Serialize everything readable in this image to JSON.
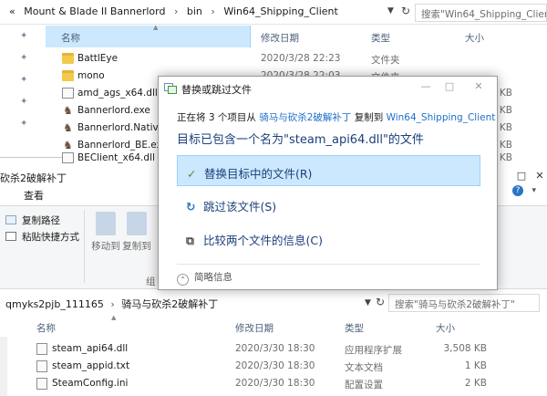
{
  "top_window": {
    "breadcrumb": [
      "«",
      "Mount & Blade II Bannerlord",
      "bin",
      "Win64_Shipping_Client"
    ],
    "breadcrumb_sep": "›",
    "search_placeholder": "搜索\"Win64_Shipping_Client\"",
    "columns": {
      "name": "名称",
      "date": "修改日期",
      "type": "类型",
      "size": "大小"
    },
    "files": [
      {
        "name": "BattlEye",
        "date": "2020/3/28 22:23",
        "type": "文件夹",
        "size": "",
        "icon": "folder"
      },
      {
        "name": "mono",
        "date": "2020/3/28 22:03",
        "type": "文件夹",
        "size": "",
        "icon": "folder"
      },
      {
        "name": "amd_ags_x64.dll",
        "date": "",
        "type": "",
        "size": "KB",
        "icon": "dll"
      },
      {
        "name": "Bannerlord.exe",
        "date": "",
        "type": "",
        "size": "KB",
        "icon": "exe"
      },
      {
        "name": "Bannerlord.Native",
        "date": "",
        "type": "",
        "size": "KB",
        "icon": "exe"
      },
      {
        "name": "Bannerlord_BE.exe",
        "date": "",
        "type": "",
        "size": "KB",
        "icon": "exe"
      },
      {
        "name": "BEClient_x64.dll",
        "date": "",
        "type": "",
        "size": "KB",
        "icon": "dll"
      }
    ]
  },
  "bottom_window": {
    "title": "砍杀2破解补丁",
    "controls": {
      "minimize": "—",
      "maximize": "□",
      "close": "✕"
    },
    "tab_view": "查看",
    "ribbon": {
      "copy_path": "复制路径",
      "paste_shortcut": "粘贴快捷方式",
      "move_to": "移动到",
      "copy_to": "复制到",
      "group": "组"
    },
    "breadcrumb": [
      "qmyks2pjb_111165",
      "骑马与砍杀2破解补丁"
    ],
    "breadcrumb_sep": "›",
    "search_placeholder": "搜索\"骑马与砍杀2破解补丁\"",
    "columns": {
      "name": "名称",
      "date": "修改日期",
      "type": "类型",
      "size": "大小"
    },
    "files": [
      {
        "name": "steam_api64.dll",
        "date": "2020/3/30 18:30",
        "type": "应用程序扩展",
        "size": "3,508 KB"
      },
      {
        "name": "steam_appid.txt",
        "date": "2020/3/30 18:30",
        "type": "文本文档",
        "size": "1 KB"
      },
      {
        "name": "SteamConfig.ini",
        "date": "2020/3/30 18:30",
        "type": "配置设置",
        "size": "2 KB"
      }
    ]
  },
  "dialog": {
    "title": "替换或跳过文件",
    "controls": {
      "minimize": "—",
      "maximize": "□",
      "close": "✕"
    },
    "progress_prefix": "正在将 3 个项目从",
    "source": "骑马与砍杀2破解补丁",
    "progress_mid": "复制到",
    "destination": "Win64_Shipping_Client",
    "headline": "目标已包含一个名为\"steam_api64.dll\"的文件",
    "options": [
      {
        "icon": "✓",
        "label": "替换目标中的文件(R)"
      },
      {
        "icon": "↻",
        "label": "跳过该文件(S)"
      },
      {
        "icon": "⧉",
        "label": "比较两个文件的信息(C)"
      }
    ],
    "details": "简略信息",
    "details_icon": "⌃"
  },
  "colors": {
    "selection_bg": "#cce8ff",
    "selection_border": "#99d1ff",
    "link_blue": "#1e6fc8",
    "headline_blue": "#1b3f7a",
    "check_green": "#3a9a3a"
  }
}
